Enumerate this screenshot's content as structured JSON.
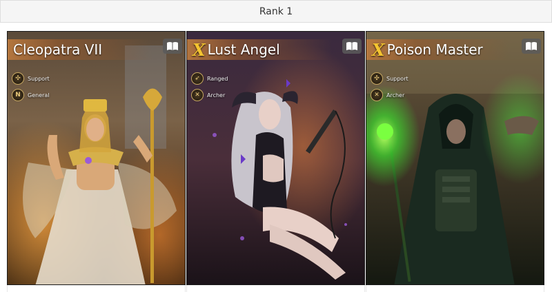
{
  "header": {
    "rank_title": "Rank 1"
  },
  "cards": [
    {
      "name": "Cleopatra VII",
      "tier_mark": "",
      "tags": [
        {
          "icon": "support-icon",
          "glyph": "✣",
          "label": "Support"
        },
        {
          "icon": "general-icon",
          "glyph": "N",
          "label": "General"
        }
      ],
      "theme_color": "#b8783e"
    },
    {
      "name": "Lust Angel",
      "tier_mark": "X",
      "tags": [
        {
          "icon": "ranged-icon",
          "glyph": "➶",
          "label": "Ranged"
        },
        {
          "icon": "archer-icon",
          "glyph": "✕",
          "label": "Archer"
        }
      ],
      "theme_color": "#7b3fc4"
    },
    {
      "name": "Poison Master",
      "tier_mark": "X",
      "tags": [
        {
          "icon": "support-icon",
          "glyph": "✣",
          "label": "Support"
        },
        {
          "icon": "archer-icon",
          "glyph": "✕",
          "label": "Archer"
        }
      ],
      "theme_color": "#3fd23a"
    }
  ]
}
